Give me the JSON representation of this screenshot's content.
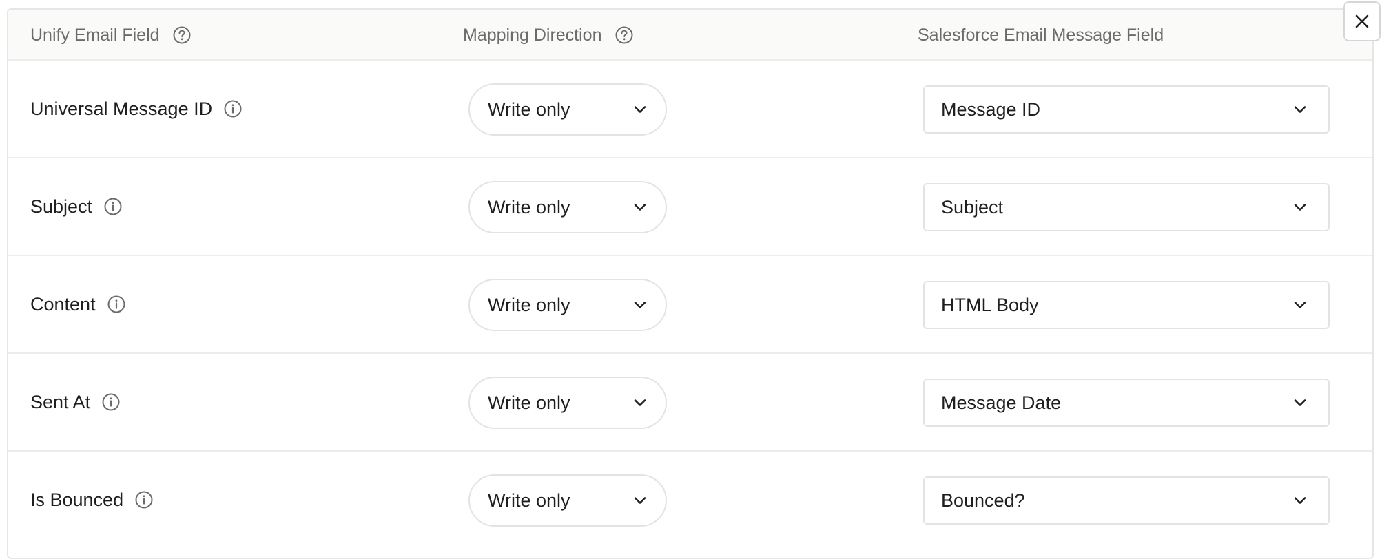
{
  "header": {
    "col_unify": "Unify Email Field",
    "col_direction": "Mapping Direction",
    "col_salesforce": "Salesforce Email Message Field"
  },
  "icons": {
    "help": "question-circle-icon",
    "info": "info-circle-icon",
    "chevron": "chevron-down-icon",
    "close": "close-icon"
  },
  "rows": [
    {
      "field": "Universal Message ID",
      "direction": "Write only",
      "salesforce_field": "Message ID"
    },
    {
      "field": "Subject",
      "direction": "Write only",
      "salesforce_field": "Subject"
    },
    {
      "field": "Content",
      "direction": "Write only",
      "salesforce_field": "HTML Body"
    },
    {
      "field": "Sent At",
      "direction": "Write only",
      "salesforce_field": "Message Date"
    },
    {
      "field": "Is Bounced",
      "direction": "Write only",
      "salesforce_field": "Bounced?"
    }
  ],
  "colors": {
    "header_bg": "#fafaf9",
    "border": "#e6e6e6",
    "text_primary": "#1f1f1f",
    "text_secondary": "#6b6b6b"
  }
}
